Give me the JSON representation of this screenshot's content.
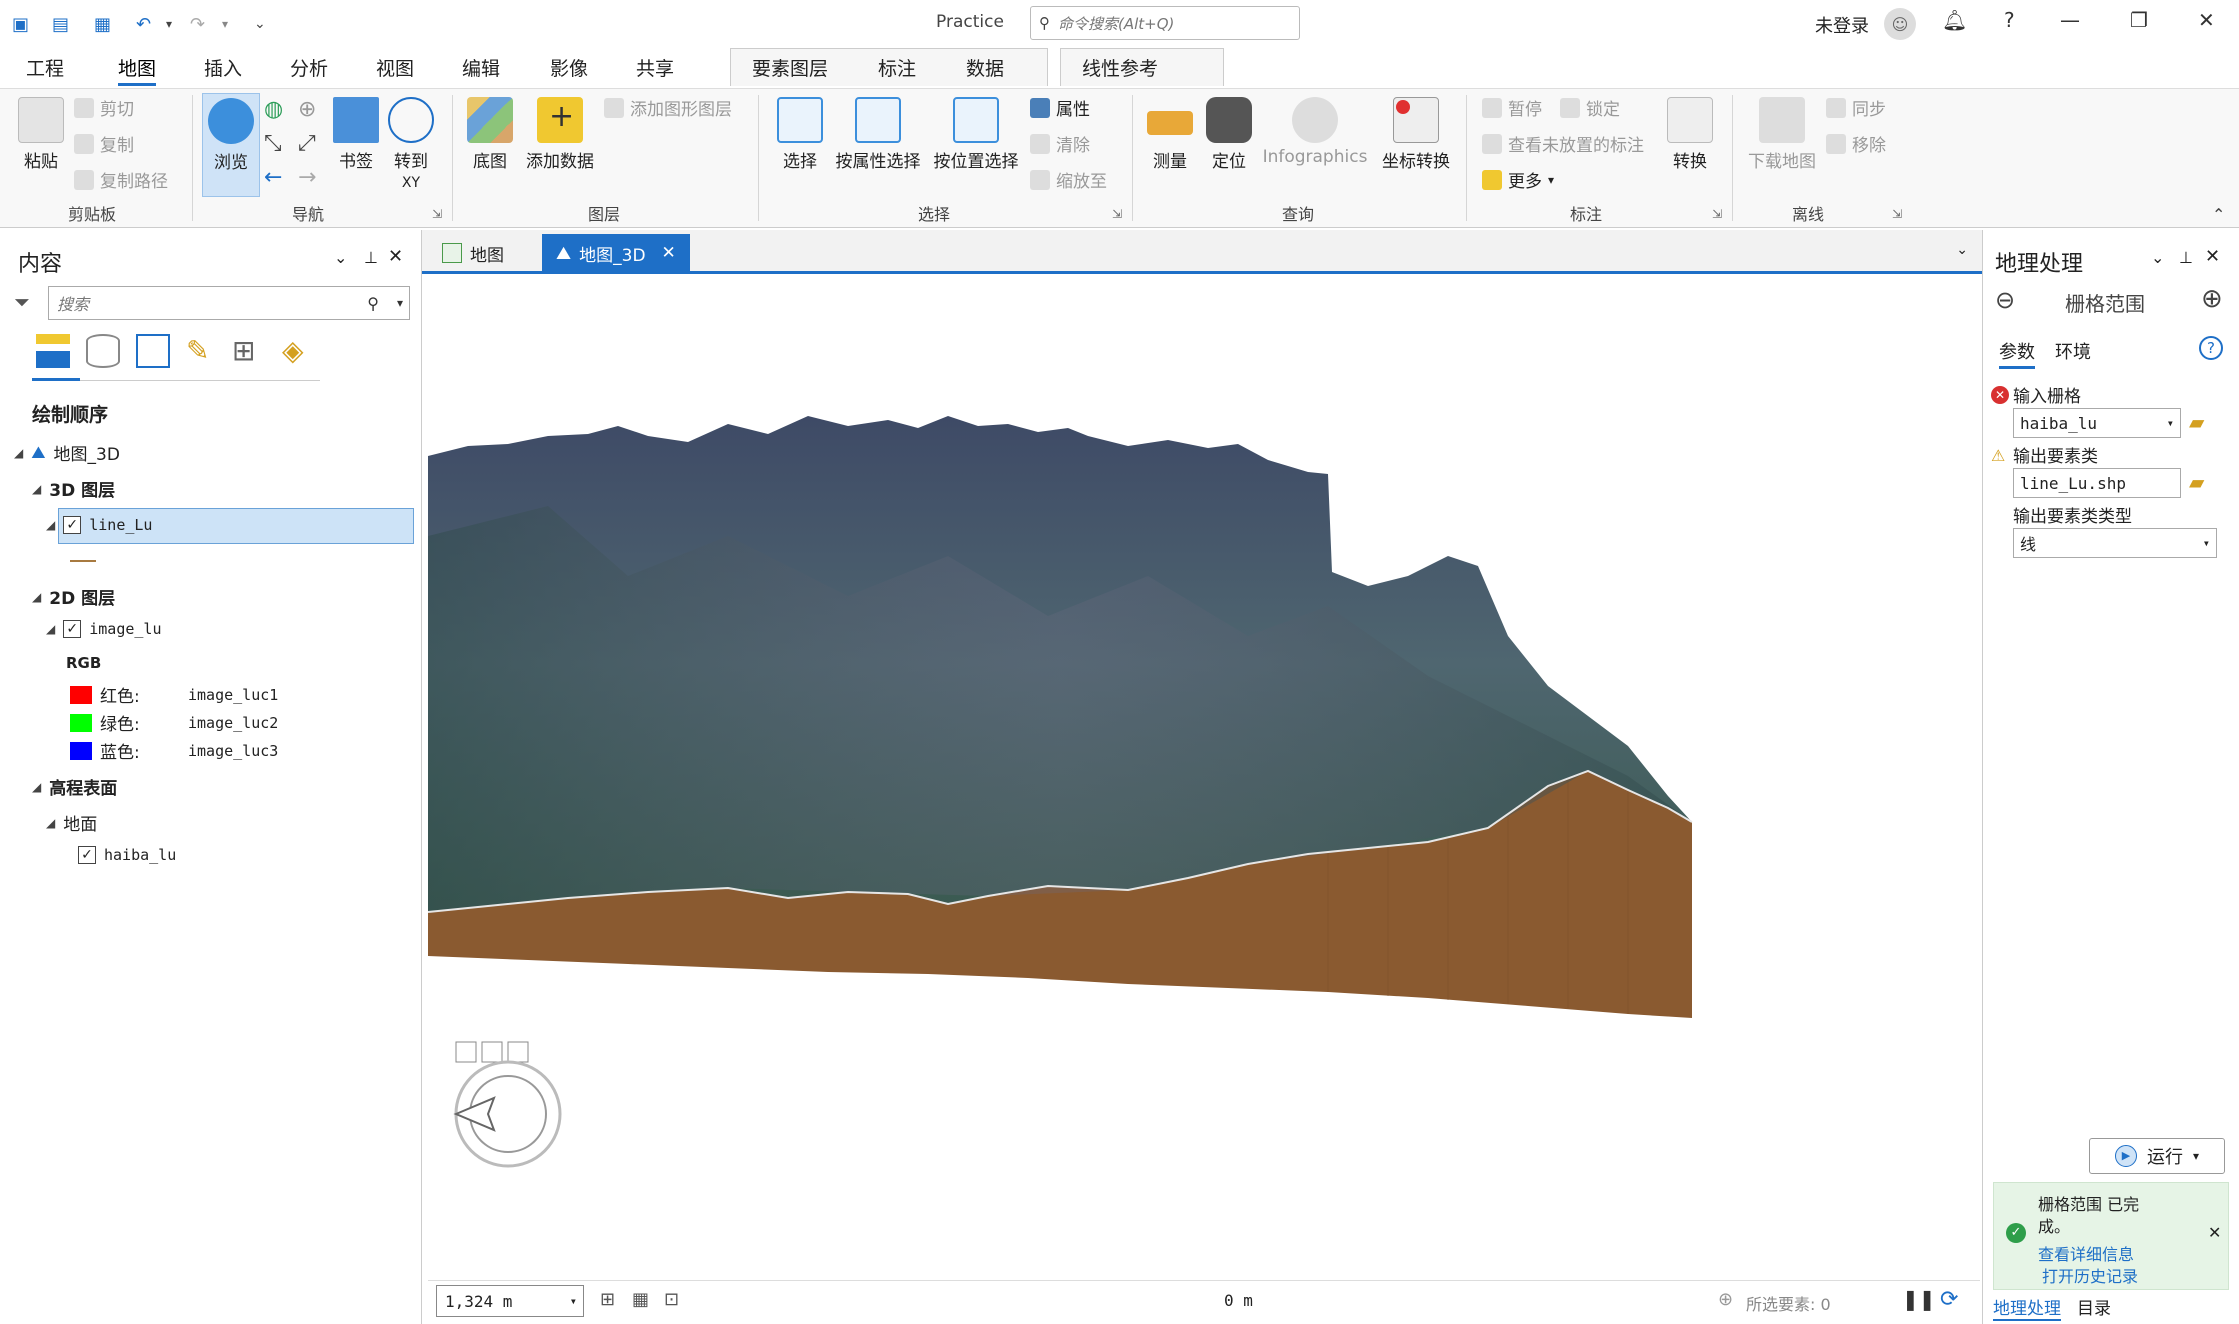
{
  "titlebar": {
    "title": "Practice",
    "search_placeholder": "命令搜索(Alt+Q)",
    "user": "未登录"
  },
  "ribbon_tabs": [
    "工程",
    "地图",
    "插入",
    "分析",
    "视图",
    "编辑",
    "影像",
    "共享",
    "要素图层",
    "标注",
    "数据",
    "线性参考"
  ],
  "active_tab": "地图",
  "ribbon": {
    "groups": {
      "clipboard": "剪贴板",
      "navigate": "导航",
      "layer": "图层",
      "selection": "选择",
      "inquiry": "查询",
      "labeling": "标注",
      "offline": "离线"
    },
    "paste": "粘贴",
    "cut": "剪切",
    "copy": "复制",
    "copy_path": "复制路径",
    "explore": "浏览",
    "bookmarks": "书签",
    "goto_xy_1": "转到",
    "goto_xy_2": "XY",
    "basemap": "底图",
    "add_data": "添加数据",
    "add_graphics_layer": "添加图形图层",
    "select": "选择",
    "select_by_attr": "按属性选择",
    "select_by_loc": "按位置选择",
    "attributes": "属性",
    "clear": "清除",
    "zoom_to": "缩放至",
    "measure": "测量",
    "locate": "定位",
    "infographics": "Infographics",
    "convert_coords": "坐标转换",
    "pause": "暂停",
    "lock": "锁定",
    "view_unplaced": "查看未放置的标注",
    "more": "更多",
    "convert": "转换",
    "download_map": "下载地图",
    "sync": "同步",
    "remove": "移除"
  },
  "contents": {
    "title": "内容",
    "search_placeholder": "搜索",
    "draw_order": "绘制顺序",
    "map_name": "地图_3D",
    "layers3d": "3D 图层",
    "line_layer": "line_Lu",
    "layers2d": "2D 图层",
    "image_layer": "image_lu",
    "rgb": "RGB",
    "red_label": "红色:",
    "red_band": "image_luc1",
    "green_label": "绿色:",
    "green_band": "image_luc2",
    "blue_label": "蓝色:",
    "blue_band": "image_luc3",
    "elevation": "高程表面",
    "ground": "地面",
    "dem": "haiba_lu"
  },
  "map_tabs": [
    "地图",
    "地图_3D"
  ],
  "status": {
    "scale": "1,324 m",
    "coord": "0 m",
    "selected": "所选要素: 0"
  },
  "geoprocessing": {
    "title": "地理处理",
    "tool": "栅格范围",
    "tab_params": "参数",
    "tab_env": "环境",
    "input_raster_label": "输入栅格",
    "input_raster": "haiba_lu",
    "output_fc_label": "输出要素类",
    "output_fc": "line_Lu.shp",
    "output_type_label": "输出要素类类型",
    "output_type": "线",
    "run": "运行",
    "done_1": "栅格范围 已完",
    "done_2": "成。",
    "view_details": "查看详细信息",
    "open_history": "打开历史记录",
    "bottom_tab1": "地理处理",
    "bottom_tab2": "目录"
  },
  "colors": {
    "accent": "#1e6fc7",
    "terrain_side": "#8a5a30",
    "red": "#ff0000",
    "green": "#00ff00",
    "blue": "#0000ff"
  }
}
